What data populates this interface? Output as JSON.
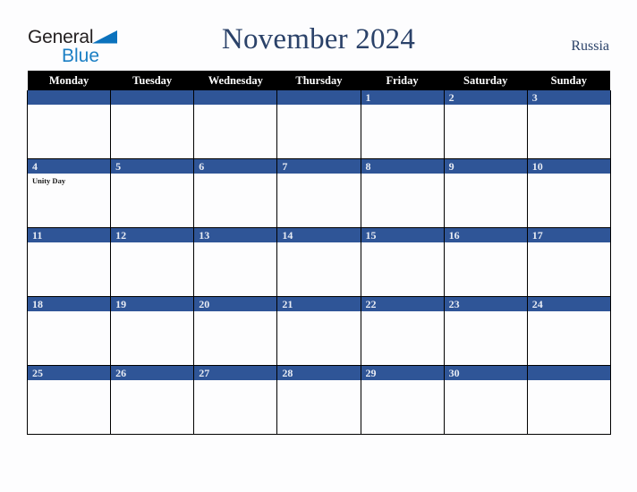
{
  "brand": {
    "name_part1": "General",
    "name_part2": "Blue",
    "triangle_color": "#0b72bd",
    "blue_text_color": "#1b7fc4",
    "dark_text_color": "#231f20"
  },
  "header": {
    "title": "November 2024",
    "country": "Russia",
    "title_color": "#2b4269"
  },
  "calendar": {
    "month": "November",
    "year": "2024",
    "weekday_headers": [
      "Monday",
      "Tuesday",
      "Wednesday",
      "Thursday",
      "Friday",
      "Saturday",
      "Sunday"
    ],
    "header_bg": "#000000",
    "header_fg": "#ffffff",
    "daybar_bg": "#2f5597",
    "daybar_fg": "#e8ecf4",
    "cell_bg": "#fdfdfe",
    "border_color": "#000000",
    "weeks": [
      [
        {
          "day": "",
          "event": ""
        },
        {
          "day": "",
          "event": ""
        },
        {
          "day": "",
          "event": ""
        },
        {
          "day": "",
          "event": ""
        },
        {
          "day": "1",
          "event": ""
        },
        {
          "day": "2",
          "event": ""
        },
        {
          "day": "3",
          "event": ""
        }
      ],
      [
        {
          "day": "4",
          "event": "Unity Day"
        },
        {
          "day": "5",
          "event": ""
        },
        {
          "day": "6",
          "event": ""
        },
        {
          "day": "7",
          "event": ""
        },
        {
          "day": "8",
          "event": ""
        },
        {
          "day": "9",
          "event": ""
        },
        {
          "day": "10",
          "event": ""
        }
      ],
      [
        {
          "day": "11",
          "event": ""
        },
        {
          "day": "12",
          "event": ""
        },
        {
          "day": "13",
          "event": ""
        },
        {
          "day": "14",
          "event": ""
        },
        {
          "day": "15",
          "event": ""
        },
        {
          "day": "16",
          "event": ""
        },
        {
          "day": "17",
          "event": ""
        }
      ],
      [
        {
          "day": "18",
          "event": ""
        },
        {
          "day": "19",
          "event": ""
        },
        {
          "day": "20",
          "event": ""
        },
        {
          "day": "21",
          "event": ""
        },
        {
          "day": "22",
          "event": ""
        },
        {
          "day": "23",
          "event": ""
        },
        {
          "day": "24",
          "event": ""
        }
      ],
      [
        {
          "day": "25",
          "event": ""
        },
        {
          "day": "26",
          "event": ""
        },
        {
          "day": "27",
          "event": ""
        },
        {
          "day": "28",
          "event": ""
        },
        {
          "day": "29",
          "event": ""
        },
        {
          "day": "30",
          "event": ""
        },
        {
          "day": "",
          "event": ""
        }
      ]
    ]
  }
}
